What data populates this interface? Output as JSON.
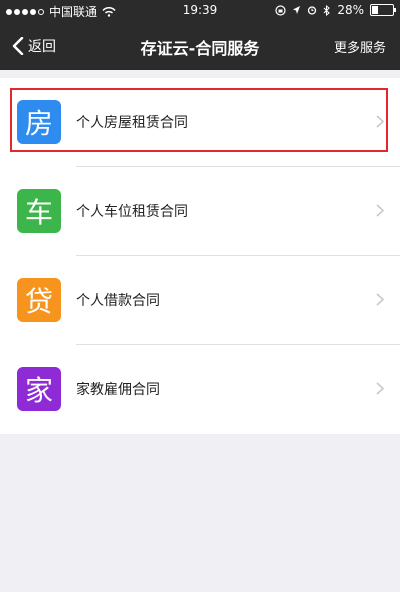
{
  "status_bar": {
    "carrier": "中国联通",
    "time": "19:39",
    "battery_percent": "28%",
    "battery_level": 0.28
  },
  "nav": {
    "back_label": "返回",
    "title": "存证云-合同服务",
    "more_label": "更多服务"
  },
  "items": [
    {
      "icon_char": "房",
      "label": "个人房屋租赁合同",
      "color": "#2e8bf0"
    },
    {
      "icon_char": "车",
      "label": "个人车位租赁合同",
      "color": "#3cb54a"
    },
    {
      "icon_char": "贷",
      "label": "个人借款合同",
      "color": "#f7941d"
    },
    {
      "icon_char": "家",
      "label": "家教雇佣合同",
      "color": "#8e2ad6"
    }
  ],
  "colors": {
    "header_bg": "#2b2b2b",
    "highlight": "#e0282e",
    "page_bg": "#efeff4"
  }
}
